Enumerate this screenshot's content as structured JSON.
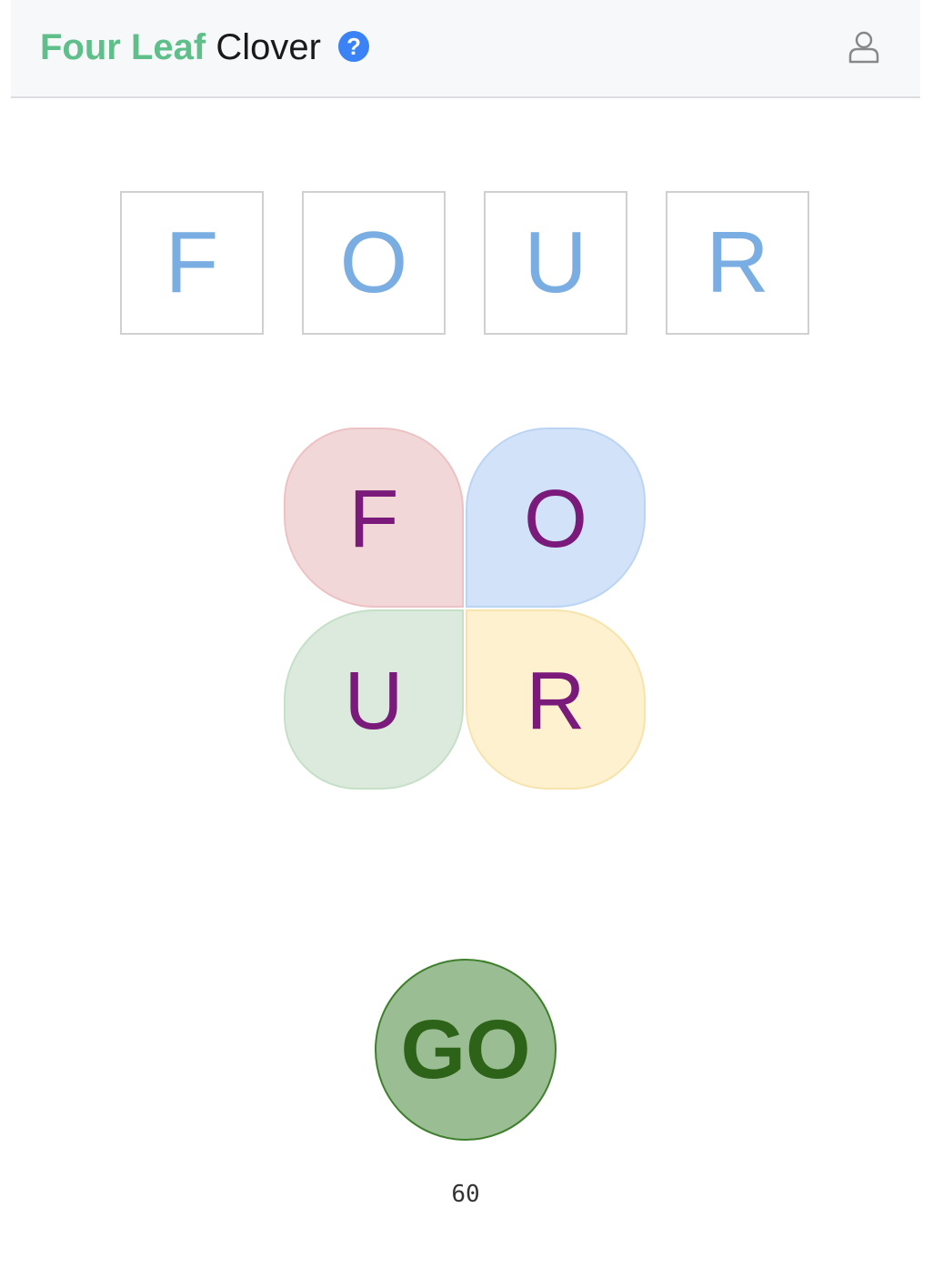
{
  "header": {
    "title_part1": "Four Leaf",
    "title_part2": "Clover",
    "help_icon": "question-circle-icon",
    "help_glyph": "?",
    "user_icon": "user-icon"
  },
  "colors": {
    "title_accent": "#5fbf8a",
    "tile_letter": "#7aaee2",
    "leaf_letter": "#7a1a7a",
    "leaf_red": "#f2d7d9",
    "leaf_blue": "#d2e3f9",
    "leaf_green": "#dbeadc",
    "leaf_yellow": "#fdf1d0",
    "go_fill": "#9abd93",
    "go_text": "#2d6318"
  },
  "answer_tiles": [
    "F",
    "O",
    "U",
    "R"
  ],
  "clover": {
    "leaves": [
      "F",
      "O",
      "U",
      "R"
    ]
  },
  "go_button": {
    "label": "GO"
  },
  "timer": {
    "value": "60"
  }
}
